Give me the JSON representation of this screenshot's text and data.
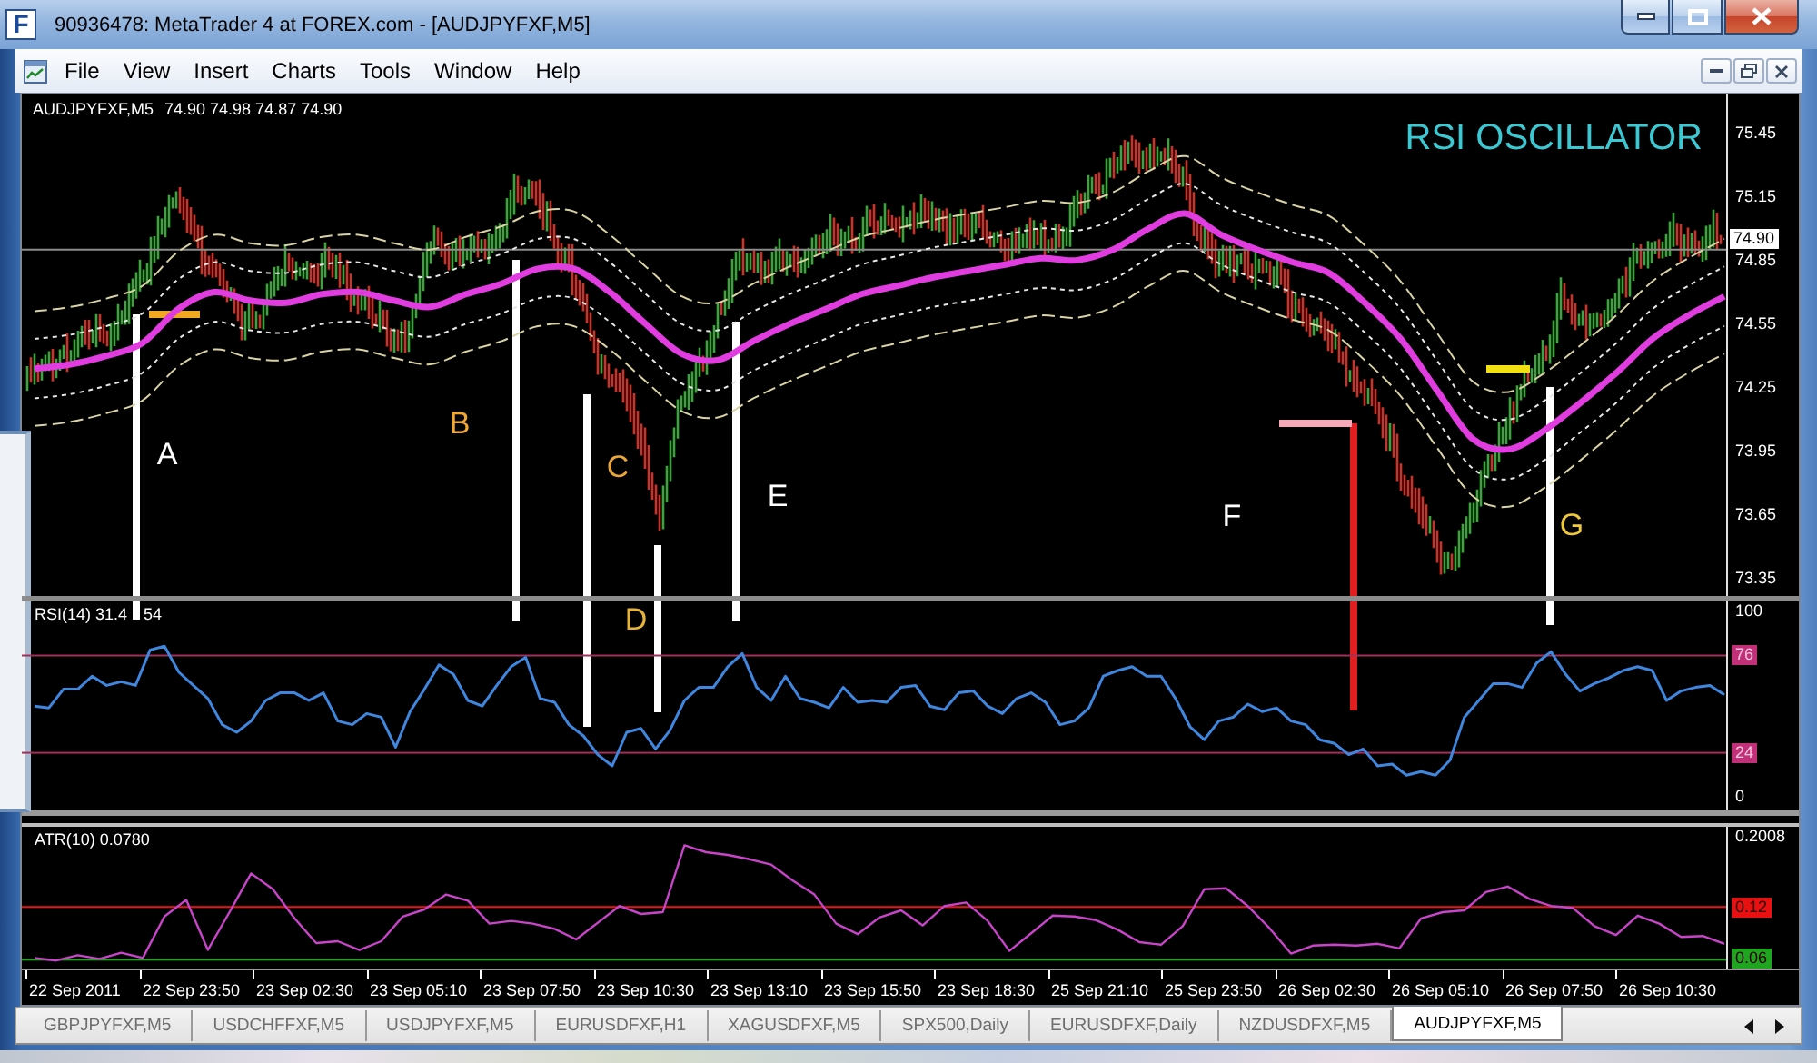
{
  "window": {
    "icon_letter": "F",
    "title": "90936478: MetaTrader 4 at FOREX.com - [AUDJPYFXF,M5]"
  },
  "menu": [
    "File",
    "View",
    "Insert",
    "Charts",
    "Tools",
    "Window",
    "Help"
  ],
  "chart": {
    "symbol": "AUDJPYFXF,M5",
    "ohlc": "74.90 74.98 74.87 74.90",
    "title": "RSI OSCILLATOR",
    "annotations": [
      {
        "label": "A",
        "color": "#ffffff"
      },
      {
        "label": "B",
        "color": "#f2a830"
      },
      {
        "label": "C",
        "color": "#e8a63a"
      },
      {
        "label": "D",
        "color": "#e6b43a"
      },
      {
        "label": "E",
        "color": "#ffffff"
      },
      {
        "label": "F",
        "color": "#ffffff"
      },
      {
        "label": "G",
        "color": "#f0c83c"
      }
    ],
    "chart_data": {
      "type": "line",
      "ylim": [
        73.27,
        75.63
      ],
      "yticks": [
        75.45,
        75.15,
        74.85,
        74.55,
        74.25,
        73.95,
        73.65,
        73.35
      ],
      "ref_lines": [
        {
          "axis": "y",
          "value": 74.9,
          "label": "74.90"
        }
      ],
      "series": [
        {
          "color": "#e03ce0",
          "values": [
            74.34,
            74.36,
            74.4,
            74.46,
            74.62,
            74.7,
            74.66,
            74.65,
            74.69,
            74.7,
            74.66,
            74.63,
            74.69,
            74.74,
            74.81,
            74.81,
            74.7,
            74.55,
            74.41,
            74.38,
            74.47,
            74.55,
            74.62,
            74.69,
            74.73,
            74.77,
            74.8,
            74.83,
            74.86,
            74.85,
            74.9,
            75.0,
            75.07,
            74.97,
            74.9,
            74.84,
            74.79,
            74.65,
            74.48,
            74.24,
            74.01,
            73.96,
            74.05,
            74.18,
            74.32,
            74.48,
            74.59,
            74.68
          ]
        },
        {
          "color": "#d9d2a4",
          "line_style": "dashed",
          "values": [
            74.61,
            74.63,
            74.67,
            74.73,
            74.89,
            74.97,
            74.93,
            74.92,
            74.96,
            74.97,
            74.93,
            74.9,
            74.96,
            75.01,
            75.08,
            75.08,
            74.97,
            74.82,
            74.68,
            74.65,
            74.74,
            74.82,
            74.89,
            74.96,
            75.0,
            75.04,
            75.07,
            75.1,
            75.13,
            75.12,
            75.17,
            75.27,
            75.34,
            75.24,
            75.17,
            75.11,
            75.06,
            74.92,
            74.75,
            74.51,
            74.28,
            74.23,
            74.32,
            74.45,
            74.59,
            74.75,
            74.86,
            74.95
          ]
        },
        {
          "color": "#e6e6e6",
          "line_style": "dotted",
          "values": [
            74.48,
            74.5,
            74.54,
            74.6,
            74.76,
            74.84,
            74.8,
            74.79,
            74.83,
            74.84,
            74.8,
            74.77,
            74.83,
            74.88,
            74.95,
            74.95,
            74.84,
            74.69,
            74.55,
            74.52,
            74.61,
            74.69,
            74.76,
            74.83,
            74.87,
            74.91,
            74.94,
            74.97,
            75.0,
            74.99,
            75.04,
            75.14,
            75.21,
            75.11,
            75.04,
            74.98,
            74.93,
            74.79,
            74.62,
            74.38,
            74.15,
            74.1,
            74.19,
            74.32,
            74.46,
            74.62,
            74.73,
            74.82
          ]
        },
        {
          "color": "#e6e6e6",
          "line_style": "dotted",
          "values": [
            74.2,
            74.22,
            74.26,
            74.32,
            74.48,
            74.56,
            74.52,
            74.51,
            74.55,
            74.56,
            74.52,
            74.49,
            74.55,
            74.6,
            74.67,
            74.67,
            74.56,
            74.41,
            74.27,
            74.24,
            74.33,
            74.41,
            74.48,
            74.55,
            74.59,
            74.63,
            74.66,
            74.69,
            74.72,
            74.71,
            74.76,
            74.86,
            74.93,
            74.83,
            74.76,
            74.7,
            74.65,
            74.51,
            74.34,
            74.1,
            73.87,
            73.82,
            73.91,
            74.04,
            74.18,
            74.34,
            74.45,
            74.54
          ]
        },
        {
          "color": "#d9d2a4",
          "line_style": "dashed",
          "values": [
            74.07,
            74.09,
            74.13,
            74.19,
            74.35,
            74.43,
            74.39,
            74.38,
            74.42,
            74.43,
            74.39,
            74.36,
            74.42,
            74.47,
            74.54,
            74.54,
            74.43,
            74.28,
            74.14,
            74.11,
            74.2,
            74.28,
            74.35,
            74.42,
            74.46,
            74.5,
            74.53,
            74.56,
            74.59,
            74.58,
            74.63,
            74.73,
            74.8,
            74.7,
            74.63,
            74.57,
            74.52,
            74.38,
            74.21,
            73.97,
            73.74,
            73.69,
            73.78,
            73.91,
            74.05,
            74.21,
            74.32,
            74.41
          ]
        }
      ]
    }
  },
  "rsi": {
    "label_parts": [
      "RSI(14) 31.4",
      "54"
    ],
    "chart_data": {
      "type": "line",
      "ylim": [
        -6.8,
        104.9
      ],
      "yticks": [
        100,
        76,
        24,
        0
      ],
      "ref_lines": [
        {
          "axis": "y",
          "value": 76
        },
        {
          "axis": "y",
          "value": 24
        }
      ],
      "series": [
        {
          "color": "#3f86de",
          "values": [
            49,
            48,
            58,
            58,
            65,
            60,
            62,
            60,
            79,
            81,
            67,
            60,
            53,
            39,
            35,
            41,
            52,
            56,
            56,
            52,
            56,
            41,
            39,
            45,
            43,
            27,
            46,
            58,
            71,
            66,
            52,
            49,
            60,
            70,
            75,
            53,
            51,
            39,
            33,
            23,
            17,
            35,
            37,
            26,
            36,
            52,
            59,
            59,
            70,
            77,
            59,
            52,
            65,
            53,
            51,
            48,
            59,
            51,
            52,
            51,
            59,
            60,
            49,
            47,
            56,
            57,
            49,
            45,
            53,
            56,
            51,
            39,
            41,
            48,
            65,
            68,
            70,
            65,
            65,
            53,
            38,
            31,
            41,
            43,
            50,
            46,
            48,
            41,
            39,
            31,
            29,
            23,
            26,
            17,
            18,
            12,
            14,
            12,
            20,
            43,
            52,
            61,
            61,
            59,
            72,
            78,
            66,
            57,
            61,
            64,
            68,
            70,
            68,
            52,
            57,
            59,
            60,
            55
          ]
        }
      ]
    }
  },
  "atr": {
    "chart_data": {
      "type": "line",
      "title": "ATR(10) 0.0780",
      "ylim": [
        0.05,
        0.211
      ],
      "yticks": [
        0.2008,
        0.12,
        0.06
      ],
      "ref_lines": [
        {
          "axis": "y",
          "value": 0.12,
          "color": "#e81010"
        },
        {
          "axis": "y",
          "value": 0.06,
          "color": "#1fa51f"
        }
      ],
      "series": [
        {
          "color": "#c844c8",
          "values": [
            0.062,
            0.059,
            0.065,
            0.061,
            0.068,
            0.062,
            0.109,
            0.128,
            0.071,
            0.114,
            0.158,
            0.14,
            0.107,
            0.079,
            0.081,
            0.071,
            0.081,
            0.109,
            0.117,
            0.134,
            0.127,
            0.101,
            0.104,
            0.101,
            0.095,
            0.083,
            0.102,
            0.121,
            0.112,
            0.114,
            0.19,
            0.182,
            0.179,
            0.174,
            0.168,
            0.15,
            0.134,
            0.101,
            0.089,
            0.108,
            0.116,
            0.099,
            0.121,
            0.125,
            0.104,
            0.07,
            0.09,
            0.11,
            0.109,
            0.105,
            0.094,
            0.08,
            0.077,
            0.098,
            0.14,
            0.141,
            0.121,
            0.096,
            0.067,
            0.076,
            0.077,
            0.076,
            0.078,
            0.073,
            0.107,
            0.114,
            0.116,
            0.137,
            0.143,
            0.129,
            0.121,
            0.119,
            0.098,
            0.088,
            0.11,
            0.101,
            0.086,
            0.087,
            0.078
          ]
        }
      ]
    }
  },
  "time_axis": [
    "22 Sep 2011",
    "22 Sep 23:50",
    "23 Sep 02:30",
    "23 Sep 05:10",
    "23 Sep 07:50",
    "23 Sep 10:30",
    "23 Sep 13:10",
    "23 Sep 15:50",
    "23 Sep 18:30",
    "25 Sep 21:10",
    "25 Sep 23:50",
    "26 Sep 02:30",
    "26 Sep 05:10",
    "26 Sep 07:50",
    "26 Sep 10:30"
  ],
  "tabs": [
    {
      "label": "GBPJPYFXF,M5",
      "selected": false
    },
    {
      "label": "USDCHFFXF,M5",
      "selected": false
    },
    {
      "label": "USDJPYFXF,M5",
      "selected": false
    },
    {
      "label": "EURUSDFXF,H1",
      "selected": false
    },
    {
      "label": "XAGUSDFXF,M5",
      "selected": false
    },
    {
      "label": "SPX500,Daily",
      "selected": false
    },
    {
      "label": "EURUSDFXF,Daily",
      "selected": false
    },
    {
      "label": "NZDUSDFXF,M5",
      "selected": false
    },
    {
      "label": "AUDJPYFXF,M5",
      "selected": true
    }
  ]
}
